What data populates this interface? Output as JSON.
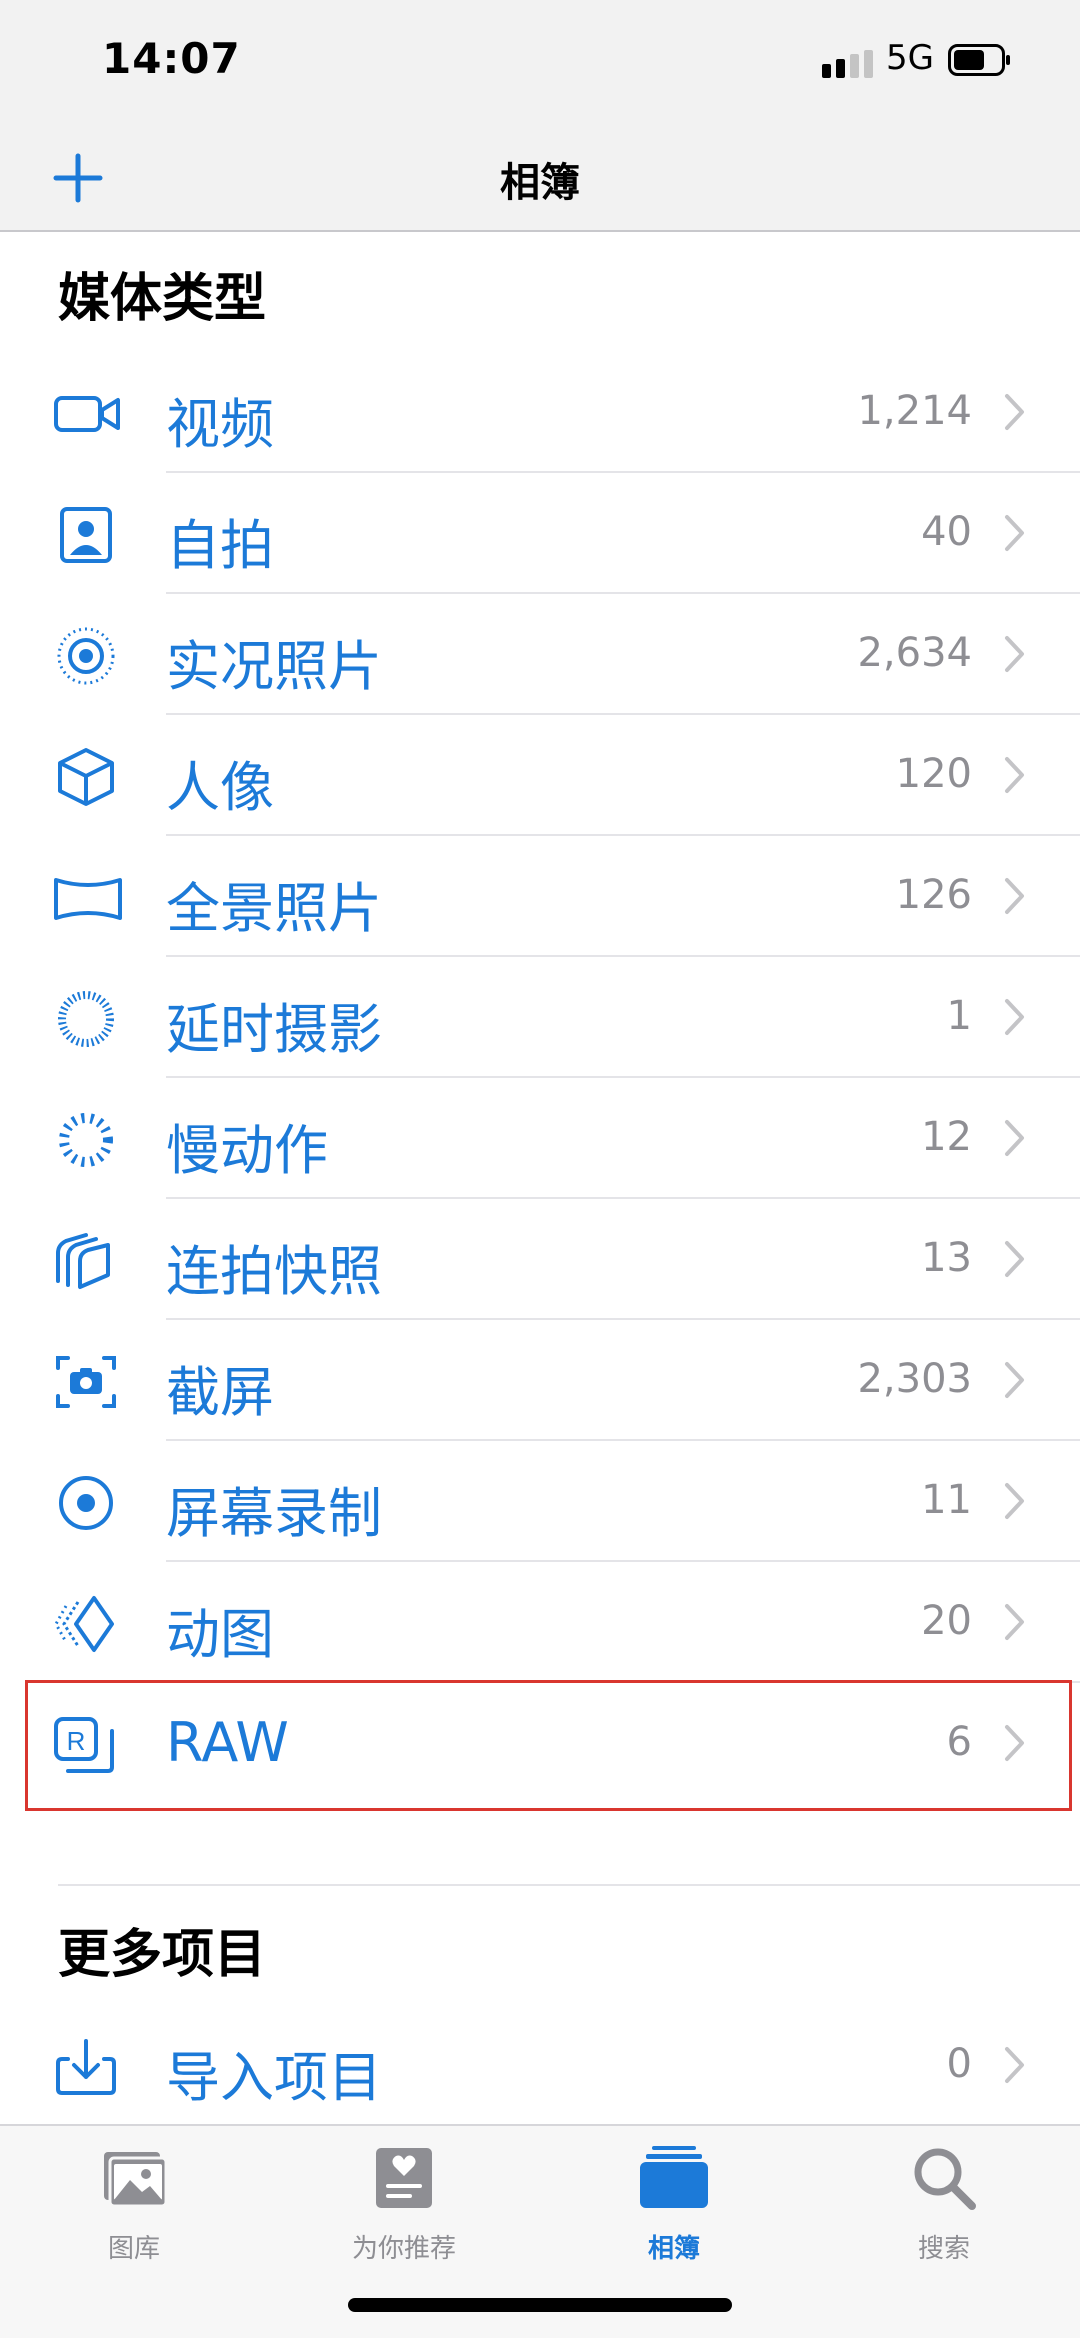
{
  "status_bar": {
    "time": "14:07",
    "network": "5G"
  },
  "nav": {
    "title": "相簿"
  },
  "media_section": {
    "title": "媒体类型",
    "items": [
      {
        "label": "视频",
        "count": "1,214",
        "icon": "video-icon"
      },
      {
        "label": "自拍",
        "count": "40",
        "icon": "selfie-icon"
      },
      {
        "label": "实况照片",
        "count": "2,634",
        "icon": "live-photo-icon"
      },
      {
        "label": "人像",
        "count": "120",
        "icon": "portrait-cube-icon"
      },
      {
        "label": "全景照片",
        "count": "126",
        "icon": "panorama-icon"
      },
      {
        "label": "延时摄影",
        "count": "1",
        "icon": "timelapse-icon"
      },
      {
        "label": "慢动作",
        "count": "12",
        "icon": "slomo-icon"
      },
      {
        "label": "连拍快照",
        "count": "13",
        "icon": "burst-icon"
      },
      {
        "label": "截屏",
        "count": "2,303",
        "icon": "screenshot-icon"
      },
      {
        "label": "屏幕录制",
        "count": "11",
        "icon": "screen-recording-icon"
      },
      {
        "label": "动图",
        "count": "20",
        "icon": "animated-icon"
      },
      {
        "label": "RAW",
        "count": "6",
        "icon": "raw-icon"
      }
    ]
  },
  "more_section": {
    "title": "更多项目",
    "items": [
      {
        "label": "导入项目",
        "count": "0",
        "icon": "import-icon"
      }
    ]
  },
  "tabs": [
    {
      "label": "图库",
      "icon": "library-icon",
      "active": false
    },
    {
      "label": "为你推荐",
      "icon": "for-you-icon",
      "active": false
    },
    {
      "label": "相簿",
      "icon": "albums-icon",
      "active": true
    },
    {
      "label": "搜索",
      "icon": "search-icon",
      "active": false
    }
  ],
  "colors": {
    "accent": "#1c7ad8",
    "secondary_text": "#8e8e93",
    "highlight_border": "#d9362f"
  }
}
